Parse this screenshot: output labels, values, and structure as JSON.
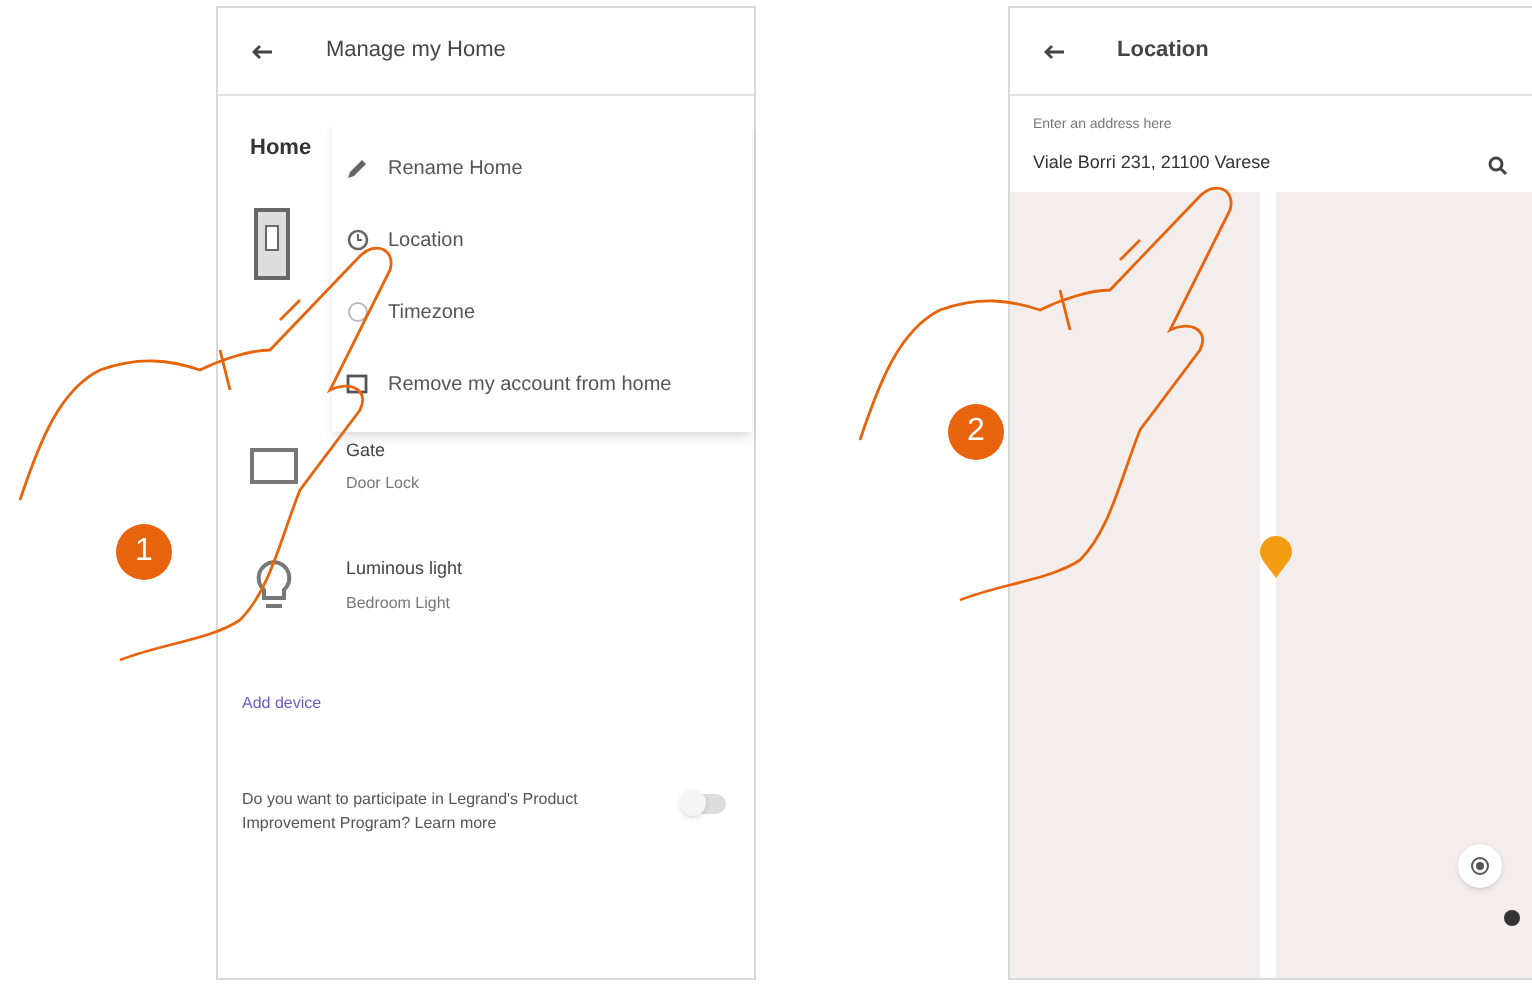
{
  "manage_screen": {
    "title": "Manage my Home",
    "section": "Home",
    "menu": [
      {
        "kind": "edit",
        "label": "Rename Home"
      },
      {
        "kind": "location",
        "label": "Location"
      },
      {
        "kind": "timezone",
        "label": "Timezone"
      },
      {
        "kind": "remove",
        "label": "Remove my account from home"
      }
    ],
    "devices": [
      {
        "kind": "gate",
        "name": "Gate",
        "subtitle": "Door Lock"
      },
      {
        "kind": "bulb",
        "name": "Luminous light",
        "subtitle": "Bedroom Light"
      }
    ],
    "link": "Add device",
    "footer_text": "Do you want to participate in Legrand's Product Improvement Program? Learn more",
    "toggle": {
      "on": false
    }
  },
  "location_screen": {
    "title": "Location",
    "field_label": "Enter an address here",
    "address": "Viale Borri 231, 21100 Varese"
  },
  "steps": [
    "1",
    "2"
  ]
}
